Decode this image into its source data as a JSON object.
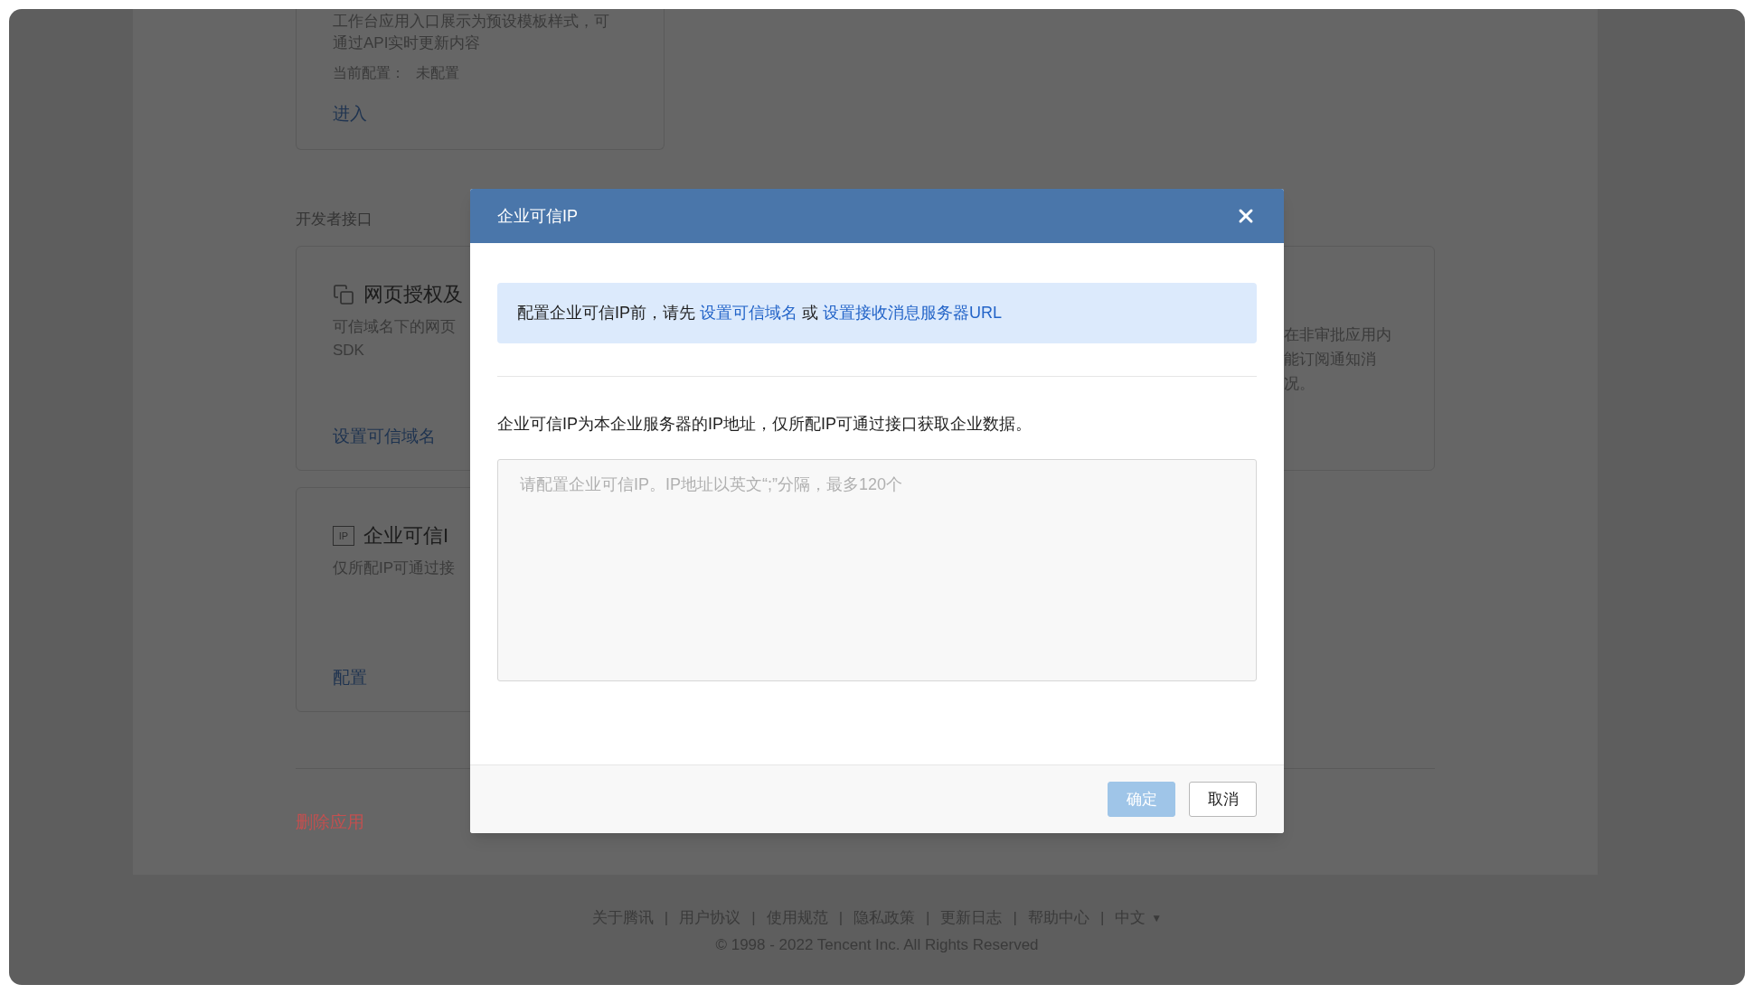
{
  "background_page": {
    "app_entry_card": {
      "description_lines": [
        "工作台应用入口展示为预设模板样式，可",
        "通过API实时更新内容"
      ],
      "config_label": "当前配置：",
      "config_value": "未配置",
      "link": "进入"
    },
    "section_title": "开发者接口",
    "cards": [
      {
        "kind": "pages",
        "title": "网页授权及",
        "description_lines": [
          "可信域名下的网页",
          "SDK"
        ],
        "link": "设置可信域名"
      },
      {
        "kind": "ip",
        "icon_text": "IP",
        "title": "企业可信I",
        "description_lines": [
          "仅所配IP可通过接"
        ],
        "link": "配置"
      }
    ],
    "right_card": {
      "description_lines": [
        "在非审批应用内",
        "能订阅通知消",
        "况。"
      ]
    },
    "delete_link": "删除应用"
  },
  "dialog": {
    "title": "企业可信IP",
    "notice": {
      "text": "配置企业可信IP前，请先",
      "link_1": "设置可信域名",
      "joiner": "或",
      "link_2": "设置接收消息服务器URL"
    },
    "description": "企业可信IP为本企业服务器的IP地址，仅所配IP可通过接口获取企业数据。",
    "ip_field": {
      "placeholder": "请配置企业可信IP。IP地址以英文“;”分隔，最多120个"
    },
    "buttons": [
      {
        "kind": "primary",
        "label": "确定",
        "disabled": true
      },
      {
        "kind": "default",
        "label": "取消",
        "disabled": false
      }
    ]
  },
  "footer": {
    "links": [
      {
        "label": "关于腾讯",
        "separator": "|"
      },
      {
        "label": "用户协议",
        "separator": "|"
      },
      {
        "label": "使用规范",
        "separator": "|"
      },
      {
        "label": "隐私政策",
        "separator": "|"
      },
      {
        "label": "更新日志",
        "separator": "|"
      },
      {
        "label": "帮助中心",
        "separator": "|"
      }
    ],
    "language": "中文",
    "language_caret": "▼",
    "copyright": "© 1998 - 2022 Tencent Inc. All Rights Reserved"
  }
}
